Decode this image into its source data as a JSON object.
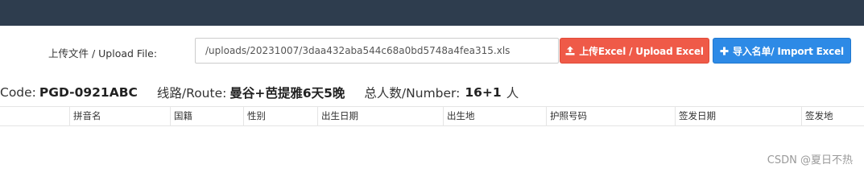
{
  "upload": {
    "label": "上传文件 / Upload File:",
    "file_value": "/uploads/20231007/3daa432aba544c68a0bd5748a4fea315.xls",
    "upload_button_label": "上传Excel / Upload Excel",
    "import_button_label": "导入名单/ Import Excel"
  },
  "info": {
    "code_label": "Code:",
    "code_value": "PGD-0921ABC",
    "route_label": "线路/Route:",
    "route_value": "曼谷+芭提雅6天5晚",
    "number_label": "总人数/Number:",
    "number_value": "16+1",
    "number_unit": "人"
  },
  "table": {
    "columns": [
      "拼音名",
      "国籍",
      "性别",
      "出生日期",
      "出生地",
      "护照号码",
      "签发日期",
      "签发地"
    ]
  },
  "watermark": "CSDN @夏日不热",
  "colors": {
    "topbar": "#2e3d4e",
    "upload_button": "#ef5a48",
    "import_button": "#2d8ae6"
  },
  "icons": {
    "upload_button": "upload-icon",
    "import_button": "plus-icon"
  }
}
